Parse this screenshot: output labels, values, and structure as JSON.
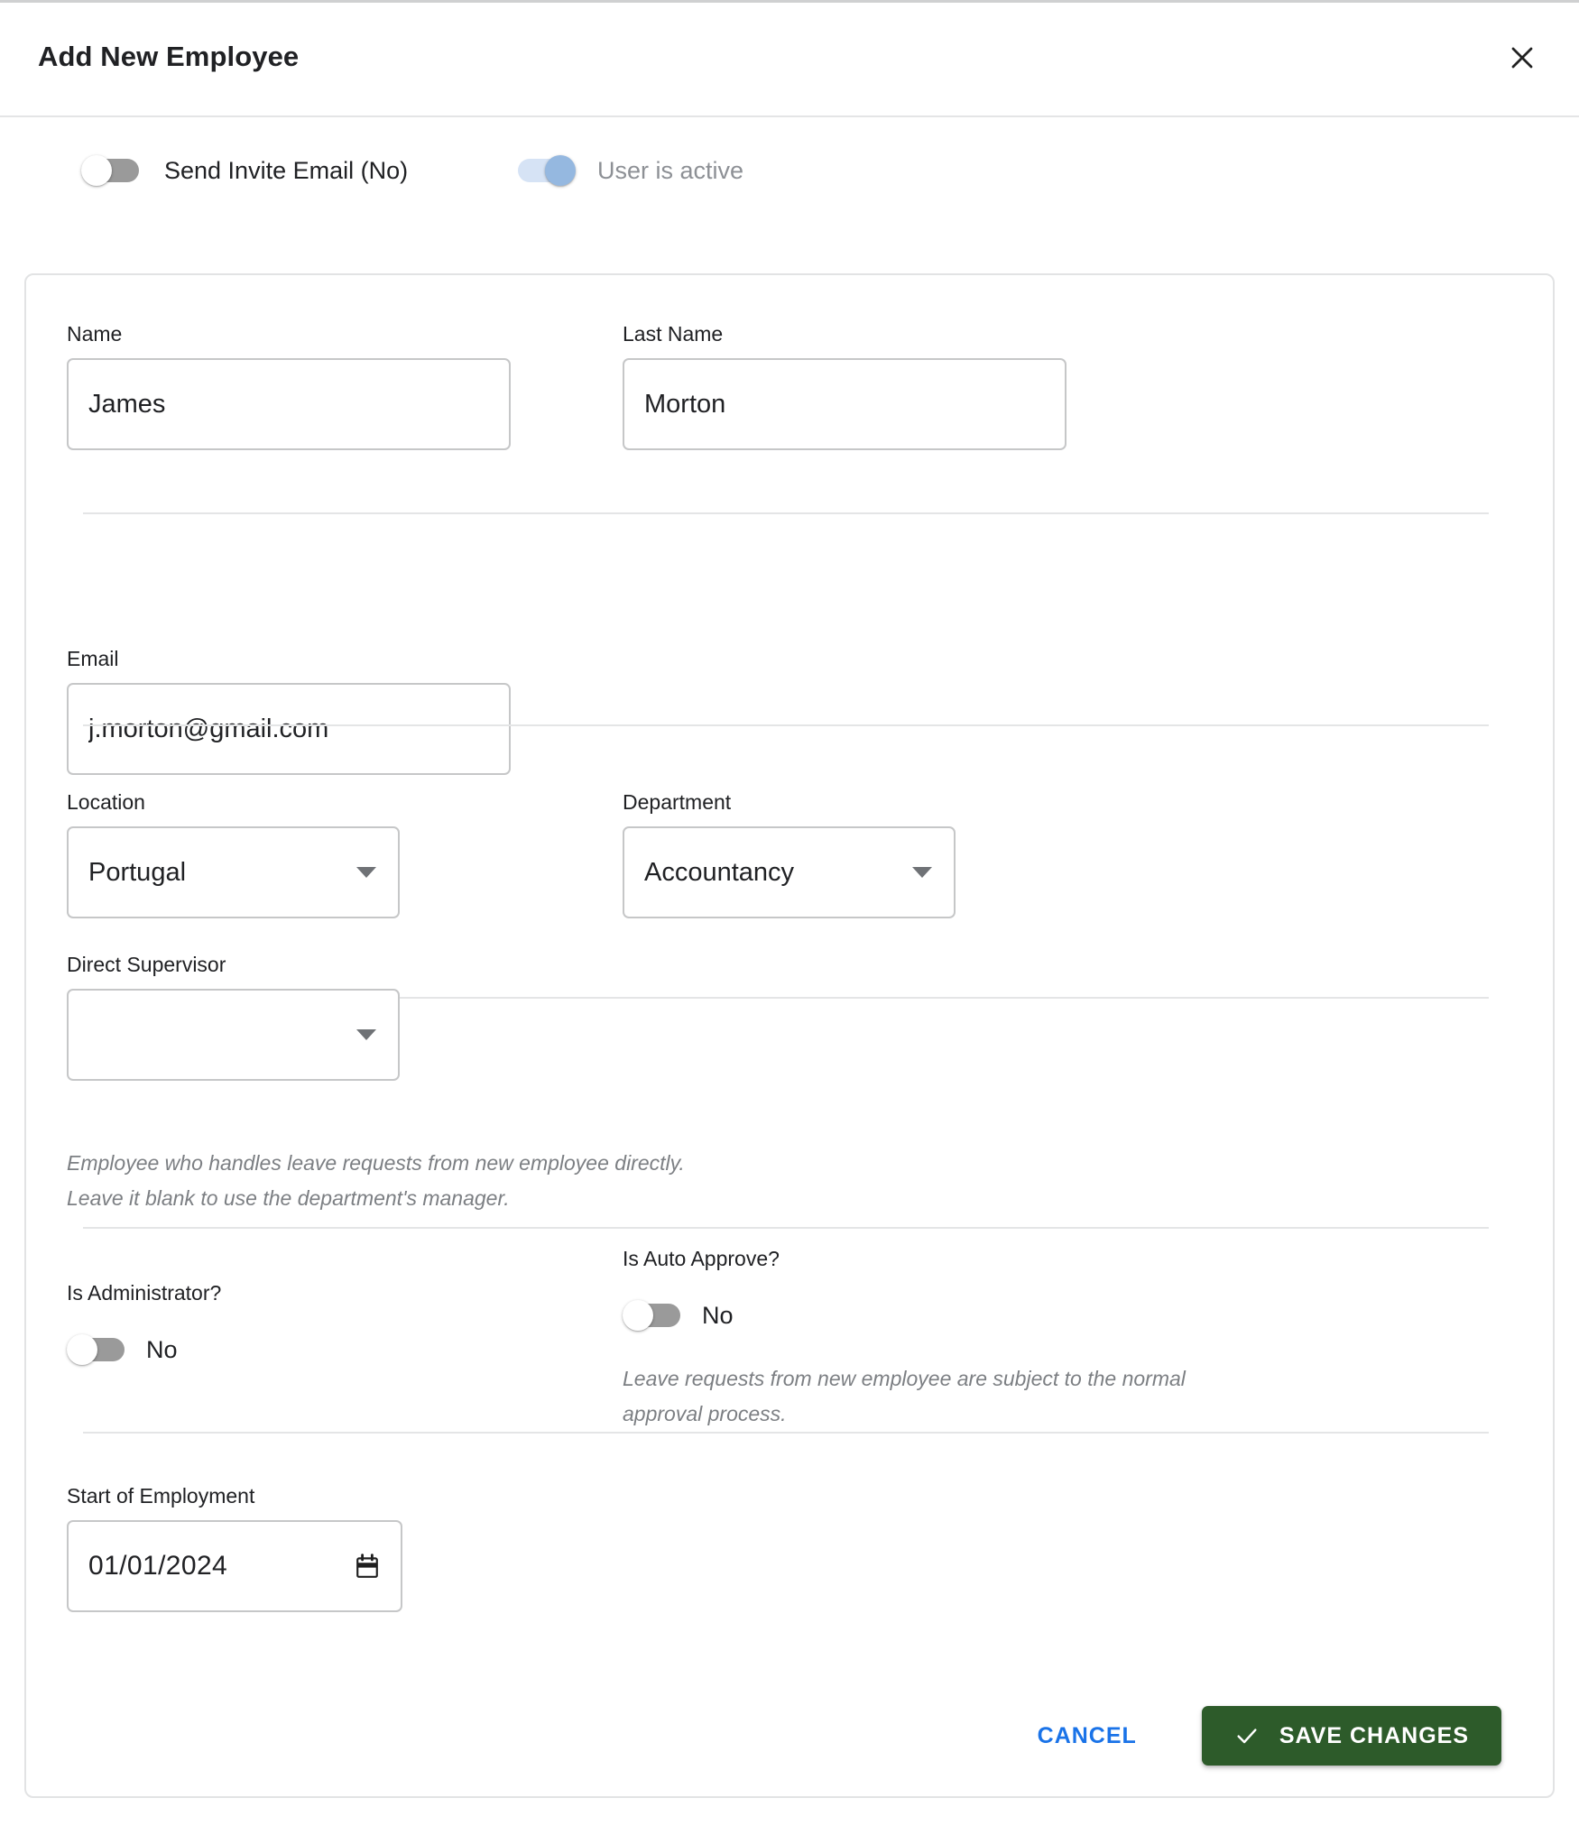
{
  "header": {
    "title": "Add New Employee",
    "close_icon": "close-icon"
  },
  "top_toggles": [
    {
      "id": "send-invite-email",
      "label": "Send Invite Email (No)",
      "state": "off",
      "muted": false
    },
    {
      "id": "user-is-active",
      "label": "User is active",
      "state": "on",
      "muted": true
    }
  ],
  "form": {
    "name": {
      "label": "Name",
      "value": "James",
      "placeholder": ""
    },
    "last_name": {
      "label": "Last Name",
      "value": "Morton",
      "placeholder": ""
    },
    "email": {
      "label": "Email",
      "value": "j.morton@gmail.com",
      "placeholder": ""
    },
    "location": {
      "label": "Location",
      "value": "Portugal"
    },
    "department": {
      "label": "Department",
      "value": "Accountancy"
    },
    "direct_supervisor": {
      "label": "Direct Supervisor",
      "value": "",
      "helper_line1": "Employee who handles leave requests from new employee directly.",
      "helper_line2": "Leave it blank to use the department's manager."
    },
    "is_administrator": {
      "label": "Is Administrator?",
      "toggle_value": "No",
      "state": "off"
    },
    "is_auto_approve": {
      "label": "Is Auto Approve?",
      "toggle_value": "No",
      "state": "off",
      "helper_line1": "Leave requests from new employee are subject to the normal",
      "helper_line2": "approval process."
    },
    "start_of_employment": {
      "label": "Start of Employment",
      "value": "01/01/2024",
      "calendar_icon": "calendar-icon"
    }
  },
  "footer": {
    "cancel_label": "CANCEL",
    "save_label": "SAVE CHANGES",
    "save_icon": "check-icon"
  },
  "colors": {
    "save_button": "#2d5b2a",
    "cancel_link": "#1a73e8",
    "toggle_on_knob": "#95b8e0",
    "toggle_on_track": "#d6e3f5",
    "toggle_off_track": "#9a9a9a",
    "border": "#c6c7c8"
  }
}
